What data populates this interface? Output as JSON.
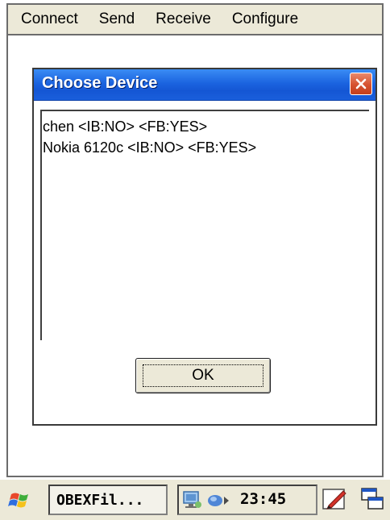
{
  "menubar": {
    "items": [
      "Connect",
      "Send",
      "Receive",
      "Configure"
    ]
  },
  "dialog": {
    "title": "Choose Device",
    "close_icon": "close-icon",
    "devices": [
      "chen <IB:NO> <FB:YES>",
      "Nokia 6120c <IB:NO> <FB:YES>"
    ],
    "ok_label": "OK"
  },
  "taskbar": {
    "start_icon": "windows-flag-icon",
    "task_label": "OBEXFil...",
    "tray_icons": [
      "network-icon",
      "connection-icon"
    ],
    "clock": "23:45",
    "edit_icon": "edit-pen-icon",
    "windows_icon": "cascade-windows-icon"
  },
  "colors": {
    "title_bar": "#1b64e0",
    "close_button": "#d6512f",
    "chrome": "#ece9d8"
  }
}
